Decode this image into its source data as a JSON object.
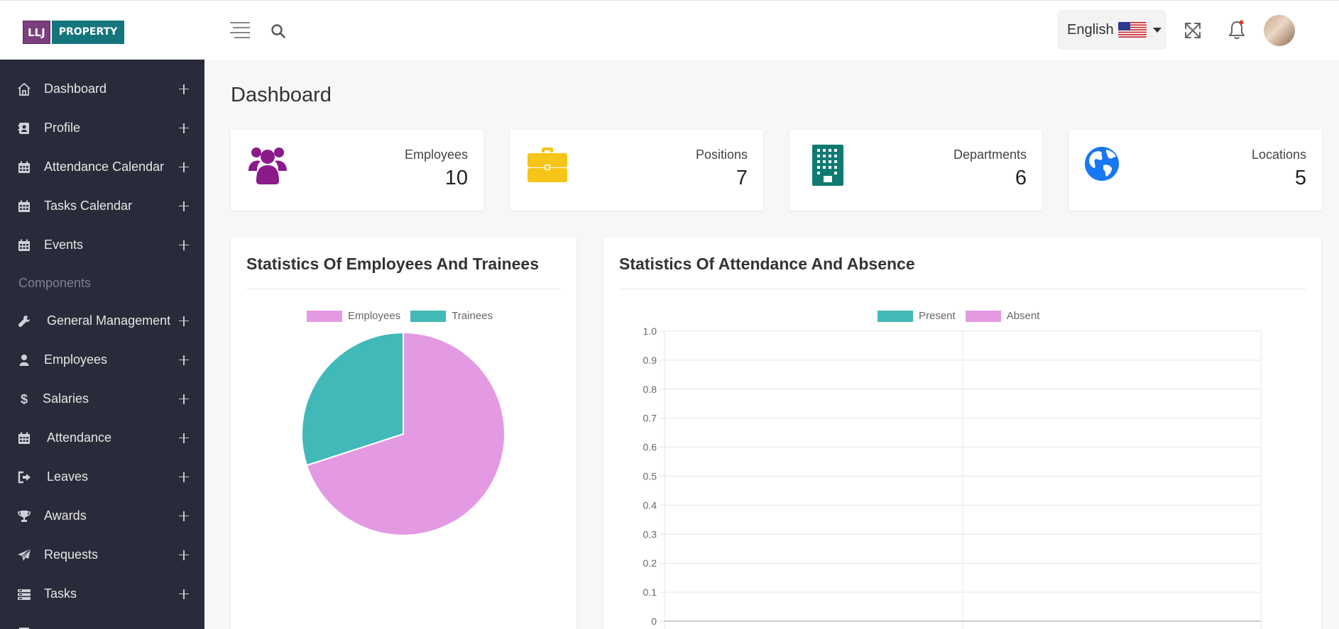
{
  "brand": {
    "part1": "LLJ",
    "part2": "PROPERTY"
  },
  "header": {
    "language": "English"
  },
  "sidebar": {
    "items": [
      {
        "label": "Dashboard",
        "icon": "home-icon"
      },
      {
        "label": "Profile",
        "icon": "contact-book-icon"
      },
      {
        "label": "Attendance Calendar",
        "icon": "calendar-icon"
      },
      {
        "label": "Tasks Calendar",
        "icon": "calendar-icon"
      },
      {
        "label": "Events",
        "icon": "calendar-icon"
      }
    ],
    "section_label": "Components",
    "component_items": [
      {
        "label": "General Management",
        "icon": "wrench-icon"
      },
      {
        "label": "Employees",
        "icon": "user-icon"
      },
      {
        "label": "Salaries",
        "icon": "dollar-icon"
      },
      {
        "label": "Attendance",
        "icon": "calendar-icon"
      },
      {
        "label": "Leaves",
        "icon": "sign-out-icon"
      },
      {
        "label": "Awards",
        "icon": "trophy-icon"
      },
      {
        "label": "Requests",
        "icon": "paper-plane-icon"
      },
      {
        "label": "Tasks",
        "icon": "tasks-icon"
      }
    ]
  },
  "main": {
    "title": "Dashboard",
    "stats": [
      {
        "label": "Employees",
        "value": "10",
        "icon": "users-icon",
        "color": "#8b1a8b"
      },
      {
        "label": "Positions",
        "value": "7",
        "icon": "briefcase-icon",
        "color": "#f5c518"
      },
      {
        "label": "Departments",
        "value": "6",
        "icon": "building-icon",
        "color": "#0e7a72"
      },
      {
        "label": "Locations",
        "value": "5",
        "icon": "globe-icon",
        "color": "#1877f2"
      }
    ]
  },
  "chart_data": [
    {
      "type": "pie",
      "title": "Statistics Of Employees And Trainees",
      "categories": [
        "Employees",
        "Trainees"
      ],
      "values": [
        7,
        3
      ],
      "colors": [
        "#e49ae3",
        "#42b9b9"
      ],
      "legend": "top"
    },
    {
      "type": "bar",
      "title": "Statistics Of Attendance And Absence",
      "series": [
        {
          "name": "Present",
          "values": [],
          "color": "#42b9b9"
        },
        {
          "name": "Absent",
          "values": [],
          "color": "#e49ae3"
        }
      ],
      "categories": [],
      "ylim": [
        0,
        1
      ],
      "yticks": [
        "1.0",
        "0.9",
        "0.8",
        "0.7",
        "0.6",
        "0.5",
        "0.4",
        "0.3",
        "0.2",
        "0.1",
        "0"
      ],
      "grid": true,
      "legend": "top"
    }
  ]
}
